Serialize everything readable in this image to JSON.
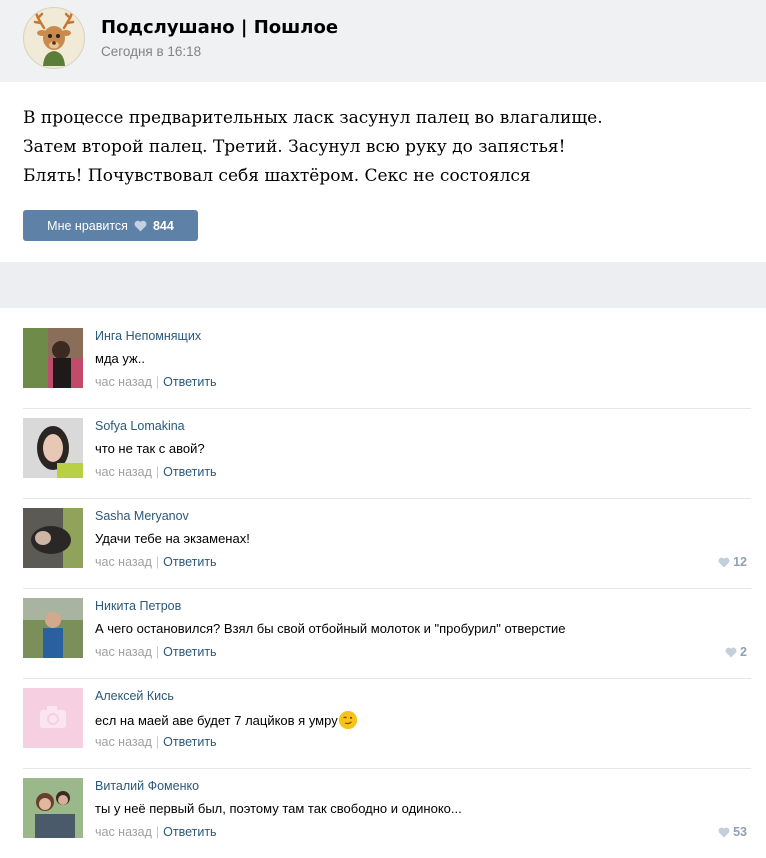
{
  "group": {
    "name": "Подслушано | Пошлое",
    "time": "Сегодня в 16:18",
    "avatar_icon": "deer-logo-icon"
  },
  "post": {
    "lines": [
      "В процессе предварительных ласк засунул палец во влагалище.",
      "Затем второй палец. Третий. Засунул всю руку до запястья!",
      "Блять! Почувствовал себя шахтёром. Секс не состоялся"
    ],
    "like_label": "Мне нравится",
    "like_count": "844"
  },
  "comments": [
    {
      "author": "Инга Непомнящих",
      "text": "мда уж..",
      "time": "час назад",
      "reply": "Ответить",
      "likes": ""
    },
    {
      "author": "Sofya Lomakina",
      "text": "что не так с авой?",
      "time": "час назад",
      "reply": "Ответить",
      "likes": ""
    },
    {
      "author": "Sasha Meryanov",
      "text": "Удачи тебе на экзаменах!",
      "time": "час назад",
      "reply": "Ответить",
      "likes": "12"
    },
    {
      "author": "Никита Петров",
      "text": "А чего остановился? Взял бы свой отбойный молоток и \"пробурил\" отверстие",
      "time": "час назад",
      "reply": "Ответить",
      "likes": "2"
    },
    {
      "author": "Алексей Кись",
      "text": "есл на маей аве будет 7 лацйков я умру",
      "time": "час назад",
      "reply": "Ответить",
      "likes": ""
    },
    {
      "author": "Виталий Фоменко",
      "text": "ты у неё первый был, поэтому там так свободно и одиноко...",
      "time": "час назад",
      "reply": "Ответить",
      "likes": "53"
    }
  ],
  "colors": {
    "accent": "#5e81a8",
    "link": "#2b587a",
    "muted": "#a0a0a0",
    "header_bg": "#f0f1f3"
  }
}
